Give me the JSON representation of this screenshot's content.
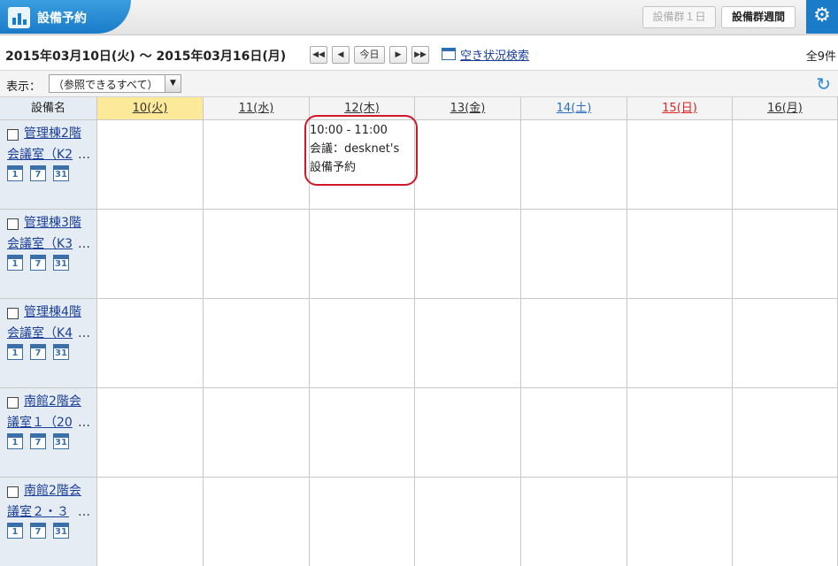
{
  "header": {
    "title": "設備予約",
    "buttons": [
      {
        "label": "設備群１日",
        "state": "disabled"
      },
      {
        "label": "設備群週間",
        "state": "active"
      }
    ],
    "gear": "gear-icon"
  },
  "toolbar": {
    "date_range": "2015年03月10日(火) ～ 2015年03月16日(月)",
    "nav": {
      "first": "◀◀",
      "prev": "◀",
      "today": "今日",
      "next": "▶",
      "last": "▶▶"
    },
    "search_link": "空き状況検索",
    "total": "全9件"
  },
  "filter": {
    "label": "表示：",
    "selected": "（参照できるすべて）",
    "refresh": "refresh-icon"
  },
  "grid": {
    "corner_label": "設備名",
    "days": [
      {
        "label": "10(火)",
        "kind": "today"
      },
      {
        "label": "11(水)",
        "kind": "weekday"
      },
      {
        "label": "12(木)",
        "kind": "weekday"
      },
      {
        "label": "13(金)",
        "kind": "weekday"
      },
      {
        "label": "14(土)",
        "kind": "saturday"
      },
      {
        "label": "15(日)",
        "kind": "sunday"
      },
      {
        "label": "16(月)",
        "kind": "weekday"
      }
    ],
    "facilities": [
      {
        "line1": "管理棟2階",
        "line2": "会議室（K2",
        "more": "…"
      },
      {
        "line1": "管理棟3階",
        "line2": "会議室（K3",
        "more": "…"
      },
      {
        "line1": "管理棟4階",
        "line2": "会議室（K4",
        "more": "…"
      },
      {
        "line1": "南館2階会",
        "line2": "議室１（20",
        "more": "…"
      },
      {
        "line1": "南館2階会",
        "line2": "議室２・３",
        "more": "…"
      }
    ],
    "cal_icons": [
      "1",
      "7",
      "31"
    ]
  },
  "events": [
    {
      "time": "10:00 - 11:00",
      "title_line1": "会議：desknet's",
      "title_line2": "設備予約"
    }
  ],
  "colors": {
    "accent": "#1a7cc8",
    "today": "#fde99a",
    "highlight": "#d0182a",
    "rowhead": "#e6ecf3"
  }
}
